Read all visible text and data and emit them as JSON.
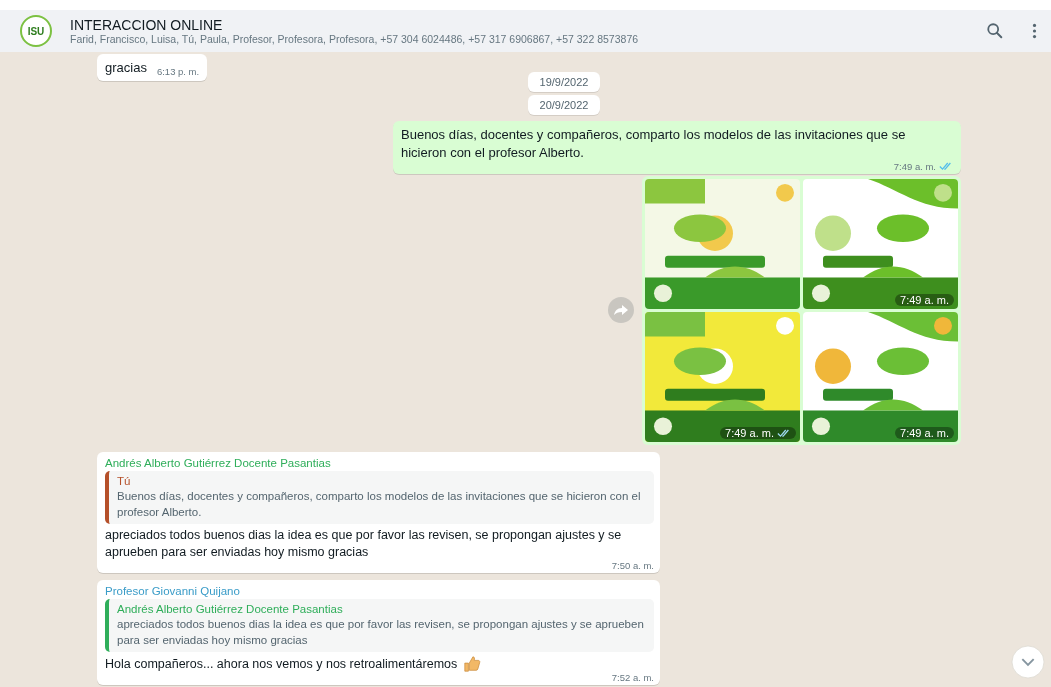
{
  "chat": {
    "avatar_label": "ISU",
    "title": "INTERACCION ONLINE",
    "participants": "Farid, Francisco, Luisa, Tú, Paula, Profesor, Profesora, Profesora, +57 304 6024486, +57 317 6906867, +57 322 8573876"
  },
  "messages": [
    {
      "kind": "in_text",
      "text": "gracias",
      "time": "6:13 p. m."
    },
    {
      "kind": "date",
      "text": "19/9/2022"
    },
    {
      "kind": "date",
      "text": "20/9/2022"
    },
    {
      "kind": "out_text",
      "text": "Buenos días, docentes y compañeros, comparto los modelos de las invitaciones que se hicieron con el profesor Alberto.",
      "time": "7:49 a. m.",
      "read": true
    },
    {
      "kind": "images",
      "images": [
        {
          "kind": "picture"
        },
        {
          "kind": "picture",
          "time": "7:49 a. m."
        },
        {
          "kind": "picture",
          "time": "7:49 a. m.",
          "read": true
        },
        {
          "kind": "picture",
          "time": "7:49 a. m."
        }
      ]
    },
    {
      "kind": "reply",
      "sender": "Andrés Alberto Gutiérrez Docente Pasantias",
      "color": "#2fae5a",
      "quote": {
        "author": "Tú",
        "color": "#b5502a",
        "text": "Buenos días, docentes y compañeros, comparto los modelos de las invitaciones que se hicieron con el profesor Alberto."
      },
      "text": "apreciados todos buenos dias la idea es que por favor las revisen, se propongan ajustes y se aprueben para ser enviadas hoy mismo gracias",
      "time": "7:50 a. m."
    },
    {
      "kind": "reply",
      "sender": "Profesor Giovanni Quijano",
      "color": "#3a9cc8",
      "quote": {
        "author": "Andrés Alberto Gutiérrez Docente Pasantias",
        "color": "#2fae5a",
        "text": "apreciados todos buenos dias la idea es que por favor las revisen, se propongan ajustes y se aprueben para ser enviadas hoy mismo gracias"
      },
      "text": "Hola compañeros... ahora nos vemos y nos retroalimentáremos",
      "thumbs_up": true,
      "time": "7:52 a. m."
    }
  ]
}
